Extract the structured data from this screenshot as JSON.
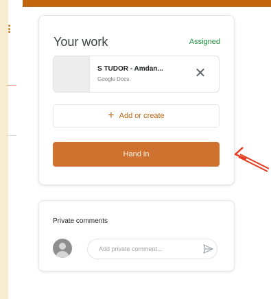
{
  "work": {
    "title": "Your work",
    "status": "Assigned",
    "attachment": {
      "name": "S TUDOR - Amdan...",
      "type": "Google Docs",
      "remove_symbol": "✕"
    },
    "add_plus": "+",
    "add_label": "Add or create",
    "hand_in_label": "Hand in"
  },
  "comments": {
    "title": "Private comments",
    "placeholder": "Add private comment..."
  },
  "colors": {
    "accent": "#c1660e",
    "hand_in_button": "#cf7230",
    "status_green": "#1e8e3e",
    "annotation_arrow": "#e53b1e"
  },
  "icons": {
    "menu": "kebab-menu-icon",
    "remove": "close-icon",
    "avatar": "user-avatar-icon",
    "send": "send-icon",
    "annotation": "red-arrow-icon"
  }
}
